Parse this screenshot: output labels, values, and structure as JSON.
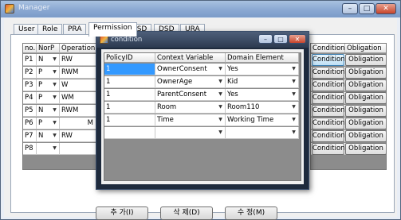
{
  "window": {
    "title": "Manager"
  },
  "tabs": [
    {
      "label": "User"
    },
    {
      "label": "Role"
    },
    {
      "label": "PRA"
    },
    {
      "label": "Permission"
    },
    {
      "label": "SSD"
    },
    {
      "label": "DSD"
    },
    {
      "label": "URA"
    }
  ],
  "left_grid": {
    "headers": [
      "no.",
      "NorP",
      "Operation"
    ],
    "rows": [
      {
        "no": "P1",
        "norp": "N",
        "op": "RW"
      },
      {
        "no": "P2",
        "norp": "P",
        "op": "RWM"
      },
      {
        "no": "P3",
        "norp": "P",
        "op": "W"
      },
      {
        "no": "P4",
        "norp": "P",
        "op": "WM"
      },
      {
        "no": "P5",
        "norp": "N",
        "op": "RWM"
      },
      {
        "no": "P6",
        "norp": "P",
        "op": "M"
      },
      {
        "no": "P7",
        "norp": "N",
        "op": "RW"
      },
      {
        "no": "P8",
        "norp": "",
        "op": ""
      }
    ]
  },
  "right_grid": {
    "headers": [
      "Condition",
      "Obligation"
    ],
    "rows": [
      {
        "c": "Condition",
        "o": "Obligation"
      },
      {
        "c": "Condition",
        "o": "Obligation"
      },
      {
        "c": "Condition",
        "o": "Obligation"
      },
      {
        "c": "Condition",
        "o": "Obligation"
      },
      {
        "c": "Condition",
        "o": "Obligation"
      },
      {
        "c": "Condition",
        "o": "Obligation"
      },
      {
        "c": "Condition",
        "o": "Obligation"
      },
      {
        "c": "Condition",
        "o": "Obligation"
      }
    ]
  },
  "buttons": {
    "add": "추 가(I)",
    "delete": "삭 제(D)",
    "edit": "수 정(M)"
  },
  "dialog": {
    "title": "condition",
    "headers": [
      "PolicyID",
      "Context Variable",
      "Domain Element"
    ],
    "rows": [
      {
        "pid": "1",
        "cv": "OwnerConsent",
        "de": "Yes"
      },
      {
        "pid": "1",
        "cv": "OwnerAge",
        "de": "Kid"
      },
      {
        "pid": "1",
        "cv": "ParentConsent",
        "de": "Yes"
      },
      {
        "pid": "1",
        "cv": "Room",
        "de": "Room110"
      },
      {
        "pid": "1",
        "cv": "Time",
        "de": "Working Time"
      },
      {
        "pid": "",
        "cv": "",
        "de": ""
      }
    ]
  }
}
